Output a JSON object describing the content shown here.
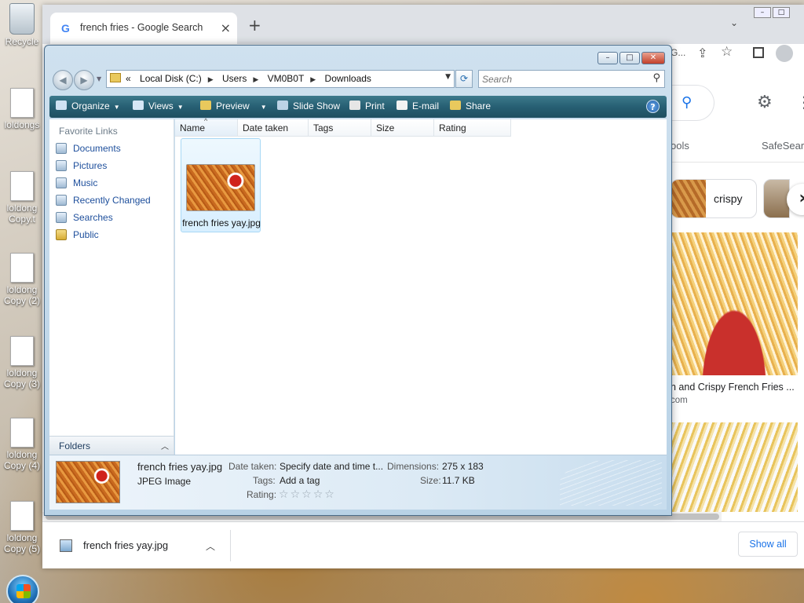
{
  "desktop": {
    "icons": [
      {
        "label": "Recycle",
        "kind": "bin"
      },
      {
        "label": "loldongs",
        "kind": "doc"
      },
      {
        "label": "loldong Copy.t",
        "kind": "doc"
      },
      {
        "label": "loldong Copy (2)",
        "kind": "doc"
      },
      {
        "label": "loldong Copy (3)",
        "kind": "doc"
      },
      {
        "label": "loldong Copy (4)",
        "kind": "doc"
      },
      {
        "label": "loldong Copy (5)",
        "kind": "doc"
      }
    ]
  },
  "chrome": {
    "tab_title": "french fries - Google Search",
    "tab_close": "×",
    "new_tab": "+",
    "tab_dropdown": "⌄",
    "omnibox_partial": "G...",
    "tools_label": "ools",
    "safesearch_label": "SafeSear",
    "chip_label": "crispy",
    "chip_next": "›",
    "result_title": "n and Crispy French Fries ...",
    "result_source": "com",
    "download": {
      "filename": "french fries yay.jpg",
      "show_all": "Show all"
    }
  },
  "explorer": {
    "address": {
      "prefix": "«",
      "crumbs": [
        "Local Disk (C:)",
        "Users",
        "VM0B0T",
        "Downloads"
      ]
    },
    "search_placeholder": "Search",
    "commands": {
      "organize": "Organize",
      "views": "Views",
      "preview": "Preview",
      "slideshow": "Slide Show",
      "print": "Print",
      "email": "E-mail",
      "share": "Share"
    },
    "nav": {
      "title": "Favorite Links",
      "links": [
        "Documents",
        "Pictures",
        "Music",
        "Recently Changed",
        "Searches",
        "Public"
      ],
      "folders": "Folders"
    },
    "columns": [
      "Name",
      "Date taken",
      "Tags",
      "Size",
      "Rating"
    ],
    "files": [
      {
        "name": "french fries yay.jpg"
      }
    ],
    "details": {
      "name": "french fries yay.jpg",
      "type": "JPEG Image",
      "date_taken_label": "Date taken:",
      "date_taken_value": "Specify date and time t...",
      "tags_label": "Tags:",
      "tags_value": "Add a tag",
      "rating_label": "Rating:",
      "rating_stars": 0,
      "dimensions_label": "Dimensions:",
      "dimensions_value": "275 x 183",
      "size_label": "Size:",
      "size_value": "11.7 KB"
    }
  }
}
